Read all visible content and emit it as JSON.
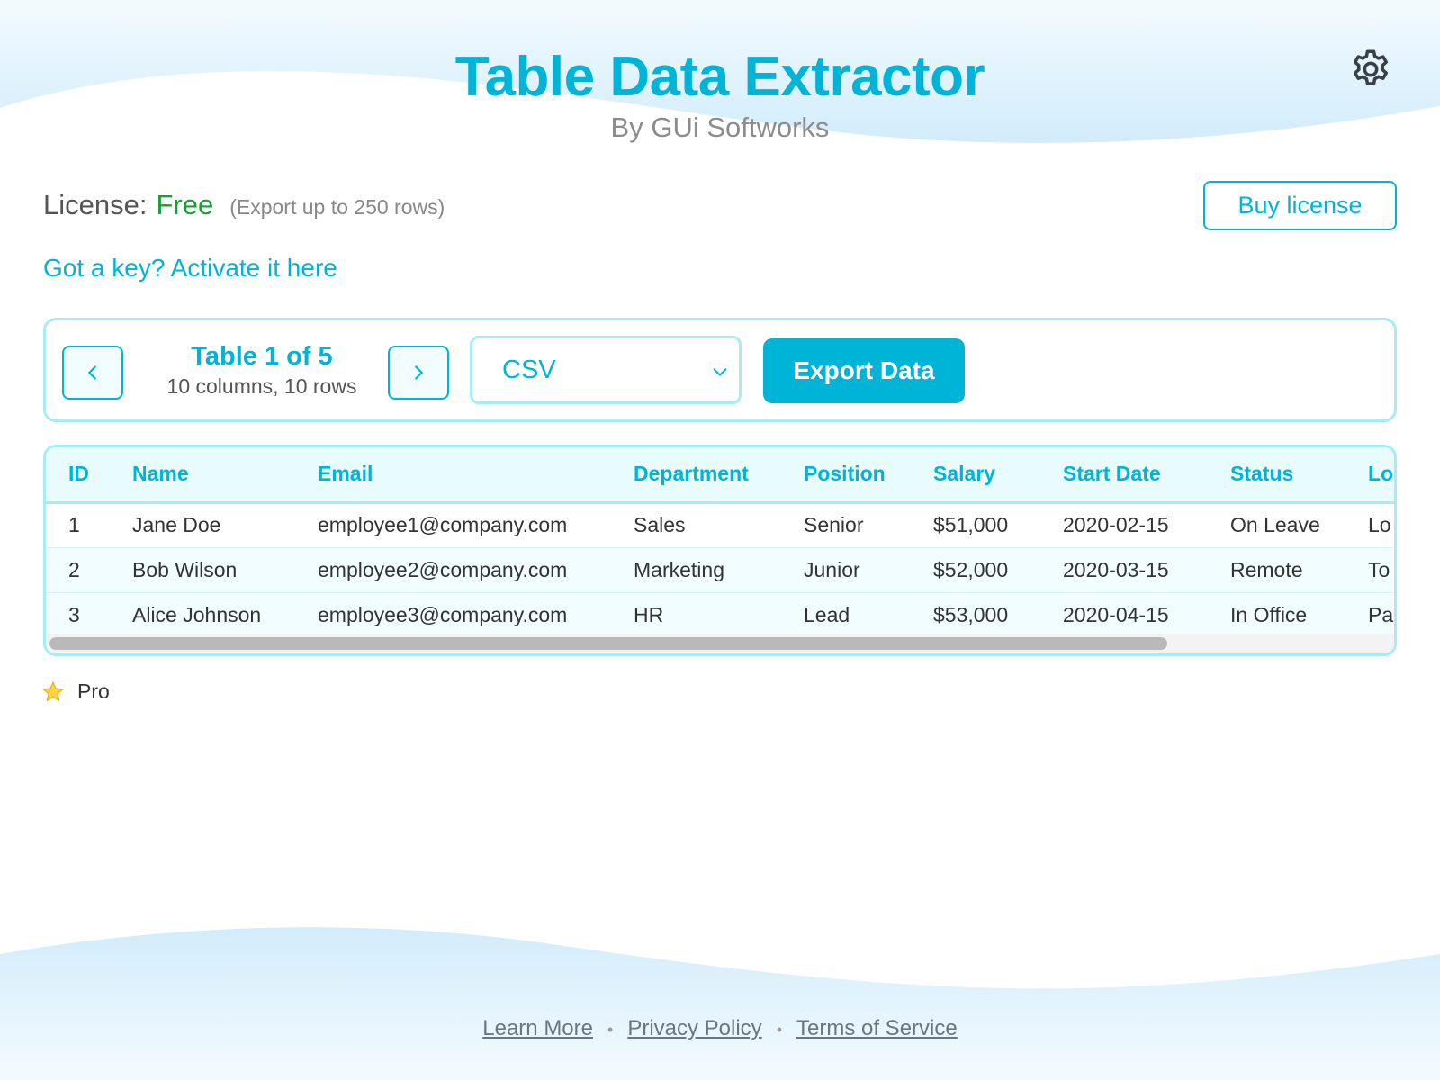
{
  "header": {
    "title": "Table Data Extractor",
    "subtitle": "By GUi Softworks"
  },
  "license": {
    "label": "License:",
    "value": "Free",
    "note": "(Export up to 250 rows)",
    "buy_label": "Buy license",
    "activate_label": "Got a key? Activate it here"
  },
  "toolbar": {
    "table_index": "Table 1 of 5",
    "table_dims": "10 columns, 10 rows",
    "format": "CSV",
    "export_label": "Export Data"
  },
  "table": {
    "columns": [
      "ID",
      "Name",
      "Email",
      "Department",
      "Position",
      "Salary",
      "Start Date",
      "Status",
      "Lo"
    ],
    "rows": [
      [
        "1",
        "Jane Doe",
        "employee1@company.com",
        "Sales",
        "Senior",
        "$51,000",
        "2020-02-15",
        "On Leave",
        "Lo"
      ],
      [
        "2",
        "Bob Wilson",
        "employee2@company.com",
        "Marketing",
        "Junior",
        "$52,000",
        "2020-03-15",
        "Remote",
        "To"
      ],
      [
        "3",
        "Alice Johnson",
        "employee3@company.com",
        "HR",
        "Lead",
        "$53,000",
        "2020-04-15",
        "In Office",
        "Pa"
      ]
    ]
  },
  "pro": {
    "label": "Pro"
  },
  "footer": {
    "links": [
      "Learn More",
      "Privacy Policy",
      "Terms of Service"
    ],
    "separator": "•"
  },
  "icons": {
    "settings": "gear-icon",
    "prev": "chevron-left-icon",
    "next": "chevron-right-icon",
    "select": "chevron-down-icon",
    "pro": "star-icon"
  },
  "colors": {
    "accent": "#00b4d8",
    "free": "#1a9e3a",
    "border": "#a6ecf5"
  }
}
